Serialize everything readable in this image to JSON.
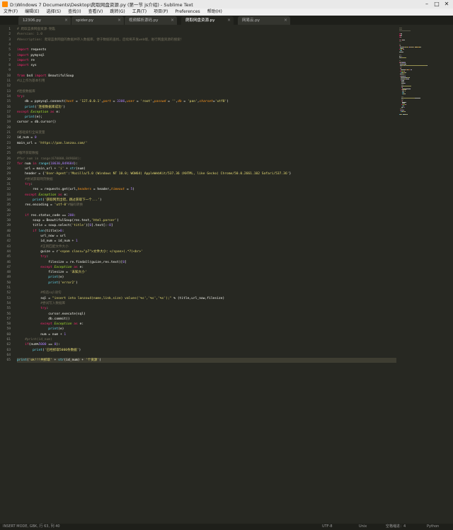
{
  "window": {
    "title": "D:\\Windows 7 Documents\\Desktop\\爬取网盘资源.py (第一节 js介绍) - Sublime Text"
  },
  "menu": [
    "文件(F)",
    "编辑(E)",
    "选择(S)",
    "查找(I)",
    "查看(V)",
    "跳转(G)",
    "工具(T)",
    "项目(P)",
    "Preferences",
    "帮助(H)"
  ],
  "tabs": [
    {
      "label": "12306.py",
      "active": false
    },
    {
      "label": "spider.py",
      "active": false
    },
    {
      "label": "视频解析源码.py",
      "active": false
    },
    {
      "label": "爬取网盘资源.py",
      "active": true
    },
    {
      "label": "网易云.py",
      "active": false
    }
  ],
  "editor": {
    "current_line": 65,
    "lines": [
      [
        [
          "# 爬取蓝奏网盘资源-钥匙",
          "cm"
        ]
      ],
      [
        [
          "#version: 1.0",
          "cm"
        ]
      ],
      [
        [
          "#description: 爬取蓝奏网盘的数据并存入数据库，便于数据的查找，后续将开发web端，进行网盘资源的搜索！",
          "cm"
        ]
      ],
      [],
      [
        [
          "import",
          "kw"
        ],
        [
          " requests",
          ""
        ]
      ],
      [
        [
          "import",
          "kw"
        ],
        [
          " pymysql",
          ""
        ]
      ],
      [
        [
          "import",
          "kw"
        ],
        [
          " re",
          ""
        ]
      ],
      [
        [
          "import",
          "kw"
        ],
        [
          " sys",
          ""
        ]
      ],
      [],
      [
        [
          "from",
          "kw"
        ],
        [
          " bs4 ",
          ""
        ],
        [
          "import",
          "kw"
        ],
        [
          " BeautifulSoup",
          ""
        ]
      ],
      [
        [
          "#以上作为基本引用",
          "cm"
        ]
      ],
      [],
      [
        [
          "#连接数据库",
          "cm"
        ]
      ],
      [
        [
          "try",
          "kw"
        ],
        [
          ":",
          ""
        ]
      ],
      [
        [
          "    db = pymysql.connect(",
          ""
        ],
        [
          "host",
          "pa"
        ],
        [
          " = ",
          ""
        ],
        [
          "'127.0.0.1'",
          "st"
        ],
        [
          ",",
          ""
        ],
        [
          "port",
          "pa"
        ],
        [
          " = ",
          ""
        ],
        [
          "3306",
          "nu"
        ],
        [
          ",",
          ""
        ],
        [
          "user",
          "pa"
        ],
        [
          " = ",
          ""
        ],
        [
          "'root'",
          "st"
        ],
        [
          ",",
          ""
        ],
        [
          "passwd",
          "pa"
        ],
        [
          " = ",
          ""
        ],
        [
          "''",
          "st"
        ],
        [
          ",",
          ""
        ],
        [
          "db",
          "pa"
        ],
        [
          " = ",
          ""
        ],
        [
          "'pan'",
          "st"
        ],
        [
          ",",
          ""
        ],
        [
          "charset",
          "pa"
        ],
        [
          "=",
          ""
        ],
        [
          "'utf8'",
          "st"
        ],
        [
          ")",
          ""
        ]
      ],
      [
        [
          "    ",
          ""
        ],
        [
          "print",
          "fn"
        ],
        [
          "(",
          ""
        ],
        [
          "'连接数据库成功'",
          "st"
        ],
        [
          ")",
          ""
        ]
      ],
      [
        [
          "except",
          "kw"
        ],
        [
          " ",
          ""
        ],
        [
          "Exception",
          "ty"
        ],
        [
          " ",
          ""
        ],
        [
          "as",
          "kw"
        ],
        [
          " e:",
          ""
        ]
      ],
      [
        [
          "    ",
          ""
        ],
        [
          "print",
          "fn"
        ],
        [
          "(e);",
          ""
        ]
      ],
      [
        [
          "cursor = db.cursor()",
          ""
        ]
      ],
      [],
      [
        [
          "#基础索引全局变量",
          "cm"
        ]
      ],
      [
        [
          "id_num = ",
          ""
        ],
        [
          "0",
          "nu"
        ]
      ],
      [
        [
          "main_url = ",
          ""
        ],
        [
          "'https://pan.lanzou.com/'",
          "st"
        ]
      ],
      [],
      [
        [
          "#循环获取数据",
          "cm"
        ]
      ],
      [
        [
          "#for num in range(670000,849684):",
          "cm"
        ]
      ],
      [
        [
          "for",
          "kw"
        ],
        [
          " num ",
          ""
        ],
        [
          "in",
          "kw"
        ],
        [
          " ",
          ""
        ],
        [
          "range",
          "fn"
        ],
        [
          "(",
          ""
        ],
        [
          "10630",
          "nu"
        ],
        [
          ",",
          ""
        ],
        [
          "849684",
          "nu"
        ],
        [
          "):",
          ""
        ]
      ],
      [
        [
          "    url = main_url + ",
          ""
        ],
        [
          "'i'",
          "st"
        ],
        [
          " + ",
          ""
        ],
        [
          "str",
          "fn"
        ],
        [
          "(num)",
          ""
        ]
      ],
      [
        [
          "    header = {",
          ""
        ],
        [
          "'User-Agent'",
          "st"
        ],
        [
          ":",
          ""
        ],
        [
          "'Mozilla/5.0 (Windows NT 10.0; WOW64) AppleWebKit/537.36 (KHTML, like Gecko) Chrome/50.0.2661.102 Safari/537.36'",
          "st"
        ],
        [
          "}",
          ""
        ]
      ],
      [
        [
          "    ",
          ""
        ],
        [
          "#尝试获取网页数据",
          "cm"
        ]
      ],
      [
        [
          "    ",
          ""
        ],
        [
          "try",
          "kw"
        ],
        [
          ":",
          ""
        ]
      ],
      [
        [
          "        res = requests.get(url,",
          ""
        ],
        [
          "headers",
          "pa"
        ],
        [
          " = header,",
          ""
        ],
        [
          "timeout",
          "pa"
        ],
        [
          " = ",
          ""
        ],
        [
          "5",
          "nu"
        ],
        [
          ")",
          ""
        ]
      ],
      [
        [
          "    ",
          ""
        ],
        [
          "except",
          "kw"
        ],
        [
          " ",
          ""
        ],
        [
          "Exception",
          "ty"
        ],
        [
          " ",
          ""
        ],
        [
          "as",
          "kw"
        ],
        [
          " e:",
          ""
        ]
      ],
      [
        [
          "        ",
          ""
        ],
        [
          "print",
          "fn"
        ],
        [
          "(",
          ""
        ],
        [
          "'获取网页出错，跳过获取下一个...'",
          "st"
        ],
        [
          ")",
          ""
        ]
      ],
      [
        [
          "    res.encoding = ",
          ""
        ],
        [
          "'utf-8'",
          "st"
        ],
        [
          "#编码转换",
          "cm"
        ]
      ],
      [],
      [
        [
          "    ",
          ""
        ],
        [
          "if",
          "kw"
        ],
        [
          " res.status_code == ",
          ""
        ],
        [
          "200",
          "nu"
        ],
        [
          ":",
          ""
        ]
      ],
      [
        [
          "        soup = BeautifulSoup(res.text,",
          ""
        ],
        [
          "'html.parser'",
          "st"
        ],
        [
          ")",
          ""
        ]
      ],
      [
        [
          "        title = soup.select(",
          ""
        ],
        [
          "'title'",
          "st"
        ],
        [
          ")[",
          ""
        ],
        [
          "0",
          "nu"
        ],
        [
          "].text[:",
          ""
        ],
        [
          "-8",
          "nu"
        ],
        [
          "]",
          ""
        ]
      ],
      [
        [
          "        ",
          ""
        ],
        [
          "if",
          "kw"
        ],
        [
          " ",
          ""
        ],
        [
          "len",
          "fn"
        ],
        [
          "(title)>",
          ""
        ],
        [
          "0",
          "nu"
        ],
        [
          ":",
          ""
        ]
      ],
      [
        [
          "            url_now = url",
          ""
        ]
      ],
      [
        [
          "            id_num = id_num + ",
          ""
        ],
        [
          "1",
          "nu"
        ]
      ],
      [
        [
          "            ",
          ""
        ],
        [
          "#正则匹配文件大小",
          "cm"
        ]
      ],
      [
        [
          "            guize = r",
          ""
        ],
        [
          "'<span class=\"p7\">文件大小：</span>(.*?)<br>'",
          "st"
        ]
      ],
      [
        [
          "            ",
          ""
        ],
        [
          "try",
          "kw"
        ],
        [
          ":",
          ""
        ]
      ],
      [
        [
          "                filesize = re.findall(guize,res.text)[",
          ""
        ],
        [
          "0",
          "nu"
        ],
        [
          "]",
          ""
        ]
      ],
      [
        [
          "            ",
          ""
        ],
        [
          "except",
          "kw"
        ],
        [
          " ",
          ""
        ],
        [
          "Exception",
          "ty"
        ],
        [
          " ",
          ""
        ],
        [
          "as",
          "kw"
        ],
        [
          " e:",
          ""
        ]
      ],
      [
        [
          "                filesize = ",
          ""
        ],
        [
          "'未知大小'",
          "st"
        ]
      ],
      [
        [
          "                ",
          ""
        ],
        [
          "print",
          "fn"
        ],
        [
          "(e)",
          ""
        ]
      ],
      [
        [
          "                ",
          ""
        ],
        [
          "print",
          "fn"
        ],
        [
          "(",
          ""
        ],
        [
          "'error2'",
          "st"
        ],
        [
          ")",
          ""
        ]
      ],
      [],
      [
        [
          "            ",
          ""
        ],
        [
          "#构造sql语句",
          "cm"
        ]
      ],
      [
        [
          "            sql = ",
          ""
        ],
        [
          "\"insert into lanzou4(name,link,size) values('%s','%s','%s');\"",
          "st"
        ],
        [
          " % (title,url_now,filesize)",
          ""
        ]
      ],
      [
        [
          "            ",
          ""
        ],
        [
          "#尝试写入数据库",
          "cm"
        ]
      ],
      [
        [
          "            ",
          ""
        ],
        [
          "try",
          "kw"
        ],
        [
          ":",
          ""
        ]
      ],
      [
        [
          "                cursor.execute(sql)",
          ""
        ]
      ],
      [
        [
          "                db.commit()",
          ""
        ]
      ],
      [
        [
          "            ",
          ""
        ],
        [
          "except",
          "kw"
        ],
        [
          " ",
          ""
        ],
        [
          "Exception",
          "ty"
        ],
        [
          " ",
          ""
        ],
        [
          "as",
          "kw"
        ],
        [
          " e:",
          ""
        ]
      ],
      [
        [
          "                ",
          ""
        ],
        [
          "print",
          "fn"
        ],
        [
          "(e)",
          ""
        ]
      ],
      [
        [
          "            num = num + ",
          ""
        ],
        [
          "1",
          "nu"
        ]
      ],
      [
        [
          "    ",
          ""
        ],
        [
          "#print(id_num)",
          "cm"
        ]
      ],
      [
        [
          "    ",
          ""
        ],
        [
          "if",
          "kw"
        ],
        [
          "(num%",
          ""
        ],
        [
          "5000",
          "nu"
        ],
        [
          " == ",
          ""
        ],
        [
          "0",
          "nu"
        ],
        [
          "):",
          ""
        ]
      ],
      [
        [
          "        ",
          ""
        ],
        [
          "print",
          "fn"
        ],
        [
          "(",
          ""
        ],
        [
          "'已经抓取5000条数据'",
          "st"
        ],
        [
          ")",
          ""
        ]
      ],
      [],
      [
        [
          "print",
          "fn"
        ],
        [
          "(",
          ""
        ],
        [
          "'ok!!!共抓取'",
          "st"
        ],
        [
          " + ",
          ""
        ],
        [
          "str",
          "fn"
        ],
        [
          "(id_num) + ",
          ""
        ],
        [
          "'个资源'",
          "st"
        ],
        [
          ")",
          ""
        ]
      ]
    ]
  },
  "statusbar": {
    "left": "INSERT MODE, GBK, 行 63, 列 40",
    "encoding": "UTF-8",
    "line_endings": "Unix",
    "tab_size": "空格缩进：4",
    "syntax": "Python"
  },
  "colors": {
    "background": "#272822",
    "gutter_text": "#8f908a",
    "comment": "#75715e",
    "keyword": "#f92672",
    "string": "#e6db74",
    "number": "#ae81ff",
    "function": "#66d9ef",
    "type": "#a6e22e",
    "param": "#fd971f",
    "plain": "#f8f8f2"
  },
  "icons": {
    "app": "sublime-text-icon",
    "minimize": "minimize-icon",
    "maximize": "maximize-icon",
    "close": "close-icon",
    "tab_close": "close-icon"
  }
}
